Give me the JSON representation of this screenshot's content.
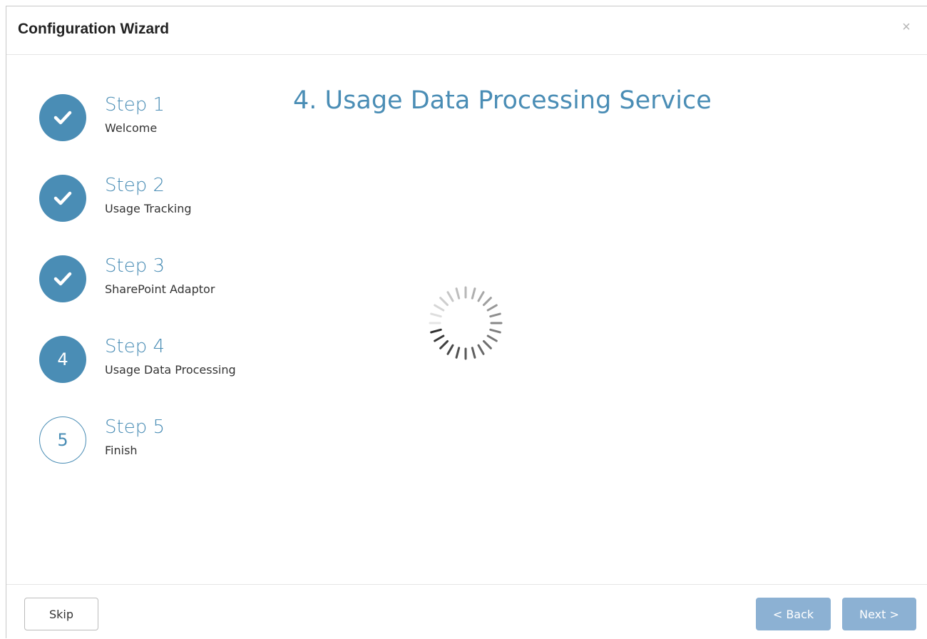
{
  "header": {
    "title": "Configuration Wizard",
    "close_label": "×"
  },
  "steps": [
    {
      "title": "Step 1",
      "subtitle": "Welcome",
      "state": "done",
      "icon": "check-icon"
    },
    {
      "title": "Step 2",
      "subtitle": "Usage Tracking",
      "state": "done",
      "icon": "check-icon"
    },
    {
      "title": "Step 3",
      "subtitle": "SharePoint Adaptor",
      "state": "done",
      "icon": "check-icon"
    },
    {
      "title": "Step 4",
      "subtitle": "Usage Data Processing",
      "state": "active",
      "number": "4"
    },
    {
      "title": "Step 5",
      "subtitle": "Finish",
      "state": "pending",
      "number": "5"
    }
  ],
  "main": {
    "title": "4. Usage Data Processing Service",
    "loading_icon": "spinner-icon"
  },
  "footer": {
    "skip_label": "Skip",
    "back_label": "< Back",
    "next_label": "Next >"
  },
  "colors": {
    "accent": "#4a8db5",
    "button_disabled": "#8cb1d3"
  }
}
